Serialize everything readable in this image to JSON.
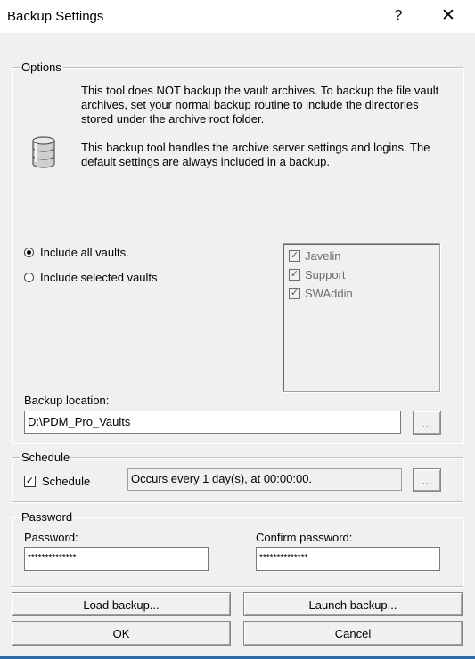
{
  "window": {
    "title": "Backup Settings",
    "help_label": "?",
    "close_label": "✕"
  },
  "options": {
    "legend": "Options",
    "info_line1": "This tool does NOT backup the vault archives. To backup the file vault archives, set your normal backup routine to include the directories stored under the archive root folder.",
    "info_line2": "This backup tool handles the archive server settings and logins. The default settings are always included in a backup.",
    "include_all_label": "Include all vaults.",
    "include_all_selected": true,
    "include_selected_label": "Include selected vaults",
    "include_selected_selected": false,
    "vaults": [
      {
        "name": "Javelin",
        "checked": true
      },
      {
        "name": "Support",
        "checked": true
      },
      {
        "name": "SWAddin",
        "checked": true
      }
    ],
    "backup_location_label": "Backup location:",
    "backup_location_value": "D:\\PDM_Pro_Vaults",
    "browse_label": "..."
  },
  "schedule": {
    "legend": "Schedule",
    "checkbox_label": "Schedule",
    "checked": true,
    "description": "Occurs every 1 day(s), at 00:00:00.",
    "edit_label": "..."
  },
  "password": {
    "legend": "Password",
    "password_label": "Password:",
    "password_value": "**************",
    "confirm_label": "Confirm password:",
    "confirm_value": "**************"
  },
  "buttons": {
    "load_backup": "Load backup...",
    "launch_backup": "Launch backup...",
    "ok": "OK",
    "cancel": "Cancel"
  }
}
